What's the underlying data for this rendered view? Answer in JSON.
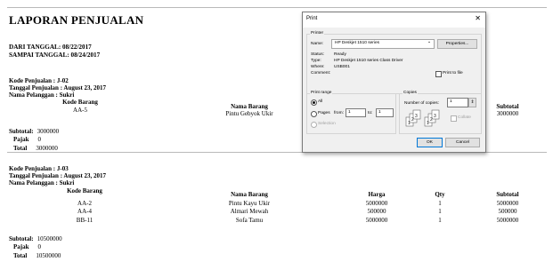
{
  "report": {
    "title": "LAPORAN PENJUALAN",
    "date_from": "DARI TANGGAL: 08/22/2017",
    "date_to": "SAMPAI TANGGAL: 08/24/2017"
  },
  "sales": [
    {
      "kode": "Kode Penjualan : J-02",
      "tanggal": "Tanggal Penjualan : August 23, 2017",
      "pelanggan": "Nama Pelanggan : Sukri",
      "headers": {
        "kode_barang": "Kode Barang",
        "nama_barang": "Nama Barang",
        "subtotal": "Subtotal"
      },
      "rows": [
        {
          "kode": "AA-5",
          "nama": "Pintu Gebyok Ukir",
          "subtotal": "3000000"
        }
      ],
      "subtotal_label": "Subtotal:",
      "subtotal_value": "3000000",
      "pajak_label": "Pajak",
      "pajak_value": "0",
      "total_label": "Total",
      "total_value": "3000000"
    },
    {
      "kode": "Kode Penjualan : J-03",
      "tanggal": "Tanggal Penjualan : August 23, 2017",
      "pelanggan": "Nama Pelanggan : Sukri",
      "headers": {
        "kode_barang": "Kode Barang",
        "nama_barang": "Nama Barang",
        "harga": "Harga",
        "qty": "Qty",
        "subtotal": "Subtotal"
      },
      "rows": [
        {
          "kode": "AA-2",
          "nama": "Pintu Kayu Ukir",
          "harga": "5000000",
          "qty": "1",
          "subtotal": "5000000"
        },
        {
          "kode": "AA-4",
          "nama": "Almari Mewah",
          "harga": "500000",
          "qty": "1",
          "subtotal": "500000"
        },
        {
          "kode": "BB-11",
          "nama": "Sofa Tamu",
          "harga": "5000000",
          "qty": "1",
          "subtotal": "5000000"
        }
      ],
      "subtotal_label": "Subtotal:",
      "subtotal_value": "10500000",
      "pajak_label": "Pajak",
      "pajak_value": "0",
      "total_label": "Total",
      "total_value": "10500000"
    }
  ],
  "print_dialog": {
    "title": "Print",
    "close_icon": "close-icon",
    "printer_group": "Printer",
    "name_label": "Name:",
    "name_value": "HP Deskjet 1510 series",
    "properties_button": "Properties...",
    "status_label": "Status:",
    "status_value": "Ready",
    "type_label": "Type:",
    "type_value": "HP Deskjet 1510 series Class Driver",
    "where_label": "Where:",
    "where_value": "USB001",
    "comment_label": "Comment:",
    "print_to_file": "Print to file",
    "print_range_group": "Print range",
    "range_all": "All",
    "range_pages": "Pages",
    "from_label": "from:",
    "from_value": "1",
    "to_label": "to:",
    "to_value": "1",
    "range_selection": "Selection",
    "copies_group": "Copies",
    "copies_label": "Number of copies:",
    "copies_value": "1",
    "collate_label": "Collate",
    "ok_button": "OK",
    "cancel_button": "Cancel"
  }
}
